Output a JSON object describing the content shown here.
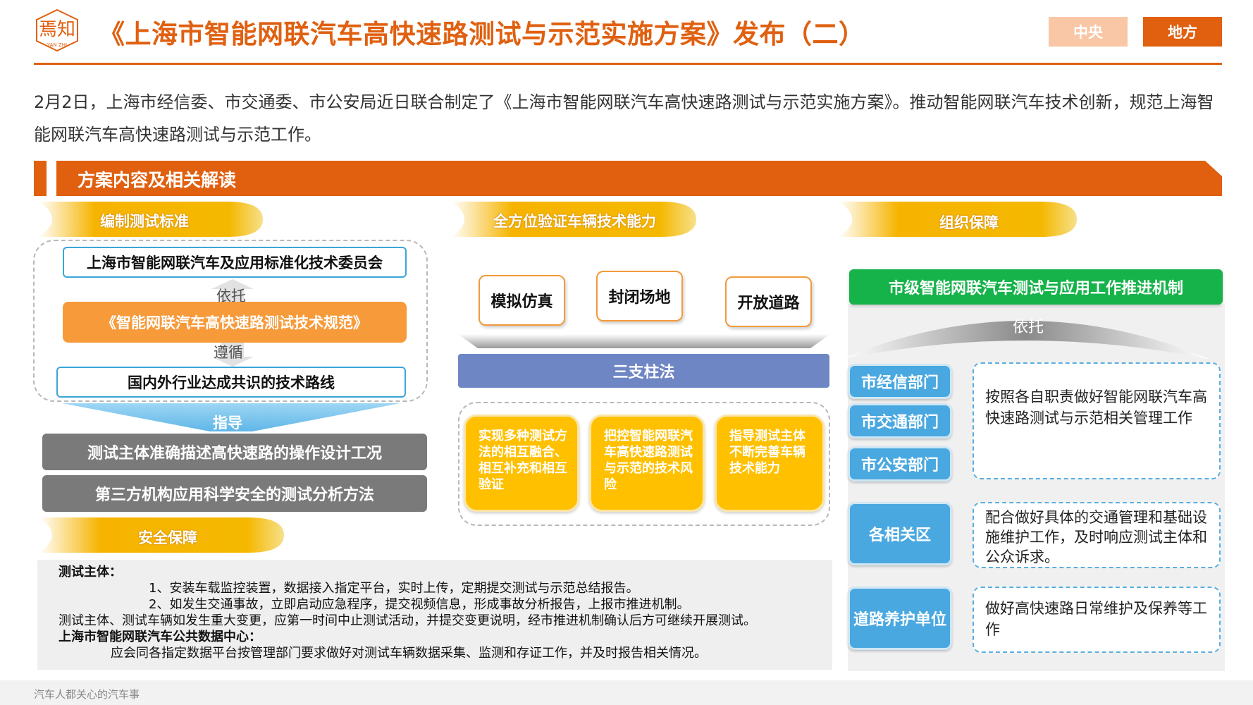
{
  "header": {
    "logo_text": "焉知",
    "logo_sub": "YAN ZHI",
    "title": "《上海市智能网联汽车高快速路测试与示范实施方案》发布（二）",
    "tab_central": "中央",
    "tab_local": "地方"
  },
  "intro": {
    "paragraph": "2月2日，上海市经信委、市交通委、市公安局近日联合制定了《上海市智能网联汽车高快速路测试与示范实施方案》。推动智能网联汽车技术创新，规范上海智能网联汽车高快速路测试与示范工作。"
  },
  "banner": {
    "title": "方案内容及相关解读"
  },
  "left": {
    "pill": "编制测试标准",
    "committee": "上海市智能网联汽车及应用标准化技术委员会",
    "rely": "依托",
    "spec": "《智能网联汽车高快速路测试技术规范》",
    "follow": "遵循",
    "route": "国内外行业达成共识的技术路线",
    "guide": "指导",
    "bar1": "测试主体准确描述高快速路的操作设计工况",
    "bar2": "第三方机构应用科学安全的测试分析方法"
  },
  "middle": {
    "pill": "全方位验证车辆技术能力",
    "methods": [
      "模拟仿真",
      "封闭场地",
      "开放道路"
    ],
    "pillar": "三支柱法",
    "cards": [
      "实现多种测试方法的相互融合、相互补充和相互验证",
      "把控智能网联汽车高快速路测试与示范的技术风险",
      "指导测试主体不断完善车辆技术能力"
    ]
  },
  "right": {
    "pill": "组织保障",
    "mechanism": "市级智能网联汽车测试与应用工作推进机制",
    "rely": "依托",
    "depts": [
      "市经信部门",
      "市交通部门",
      "市公安部门",
      "各相关区",
      "道路养护单位"
    ],
    "duties": [
      "按照各自职责做好智能网联汽车高快速路测试与示范相关管理工作",
      "配合做好具体的交通管理和基础设施维护工作，及时响应测试主体和公众诉求。",
      "做好高快速路日常维护及保养等工作"
    ]
  },
  "safety": {
    "pill": "安全保障",
    "h1": "测试主体：",
    "l1": "1、安装车载监控装置，数据接入指定平台，实时上传，定期提交测试与示范总结报告。",
    "l2": "2、如发生交通事故，立即启动应急程序，提交视频信息，形成事故分析报告，上报市推进机制。",
    "l3": "测试主体、测试车辆如发生重大变更，应第一时间中止测试活动，并提交变更说明，经市推进机制确认后方可继续开展测试。",
    "h2": "上海市智能网联汽车公共数据中心：",
    "l4": "应会同各指定数据平台按管理部门要求做好对测试车辆数据采集、监测和存证工作，并及时报告相关情况。"
  },
  "footer": {
    "text": "汽车人都关心的汽车事"
  },
  "colors": {
    "brand": "#e06010",
    "pill": "#f5b800",
    "green": "#16b34a",
    "blue": "#4aa8e0",
    "yellow": "#ffc000"
  }
}
